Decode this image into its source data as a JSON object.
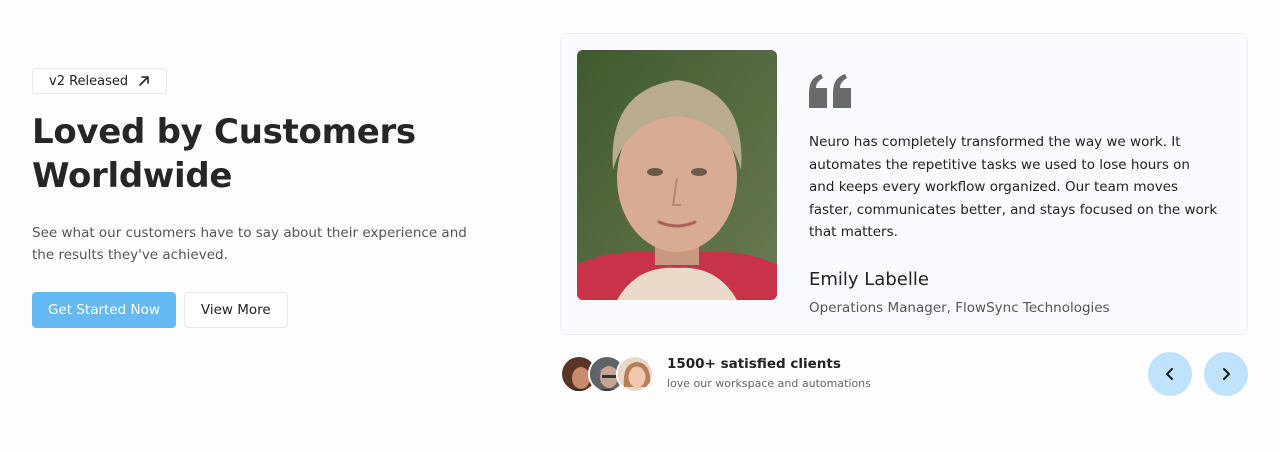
{
  "hero": {
    "badge_label": "v2 Released",
    "title_line1": "Loved by Customers",
    "title_line2": "Worldwide",
    "subtitle": "See what our customers have to say about their experience and the results they've achieved.",
    "primary_button": "Get Started Now",
    "secondary_button": "View More"
  },
  "testimonial": {
    "quote": "Neuro has completely transformed the way we work. It automates the repetitive tasks we used to lose hours on and keeps every workflow organized. Our team moves faster, communicates better, and stays focused on the work that matters.",
    "author_name": "Emily Labelle",
    "author_title": "Operations Manager, FlowSync Technologies"
  },
  "social_proof": {
    "title": "1500+ satisfied clients",
    "subtitle": "love our workspace and automations"
  },
  "colors": {
    "primary": "#64b9f2",
    "nav_button": "#bfe3fd"
  },
  "icons": {
    "badge": "arrow-up-right-icon",
    "quote": "quote-icon",
    "prev": "chevron-left-icon",
    "next": "chevron-right-icon"
  }
}
